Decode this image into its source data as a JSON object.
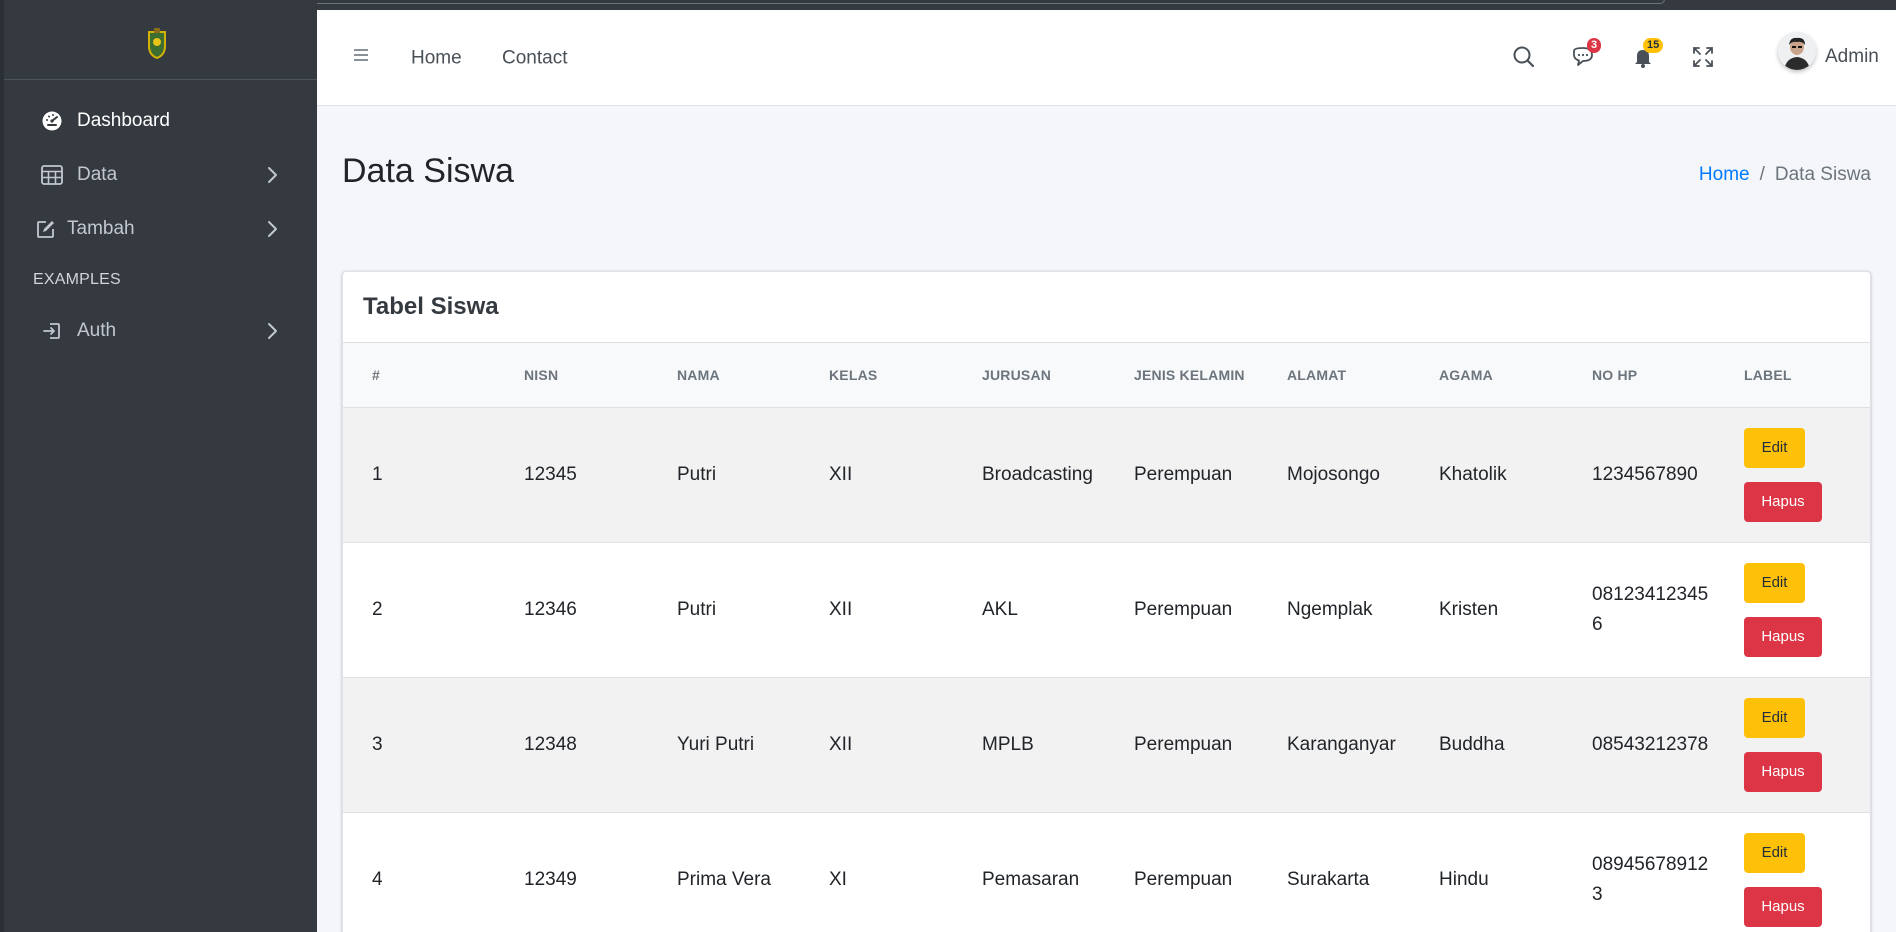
{
  "sidebar": {
    "items": [
      {
        "label": "Dashboard",
        "icon": "dashboard-icon"
      },
      {
        "label": "Data",
        "icon": "table-icon"
      },
      {
        "label": "Tambah",
        "icon": "edit-icon"
      },
      {
        "label": "Auth",
        "icon": "login-icon"
      }
    ],
    "section_header": "EXAMPLES"
  },
  "navbar": {
    "links": [
      "Home",
      "Contact"
    ],
    "messages_count": "3",
    "notifications_count": "15",
    "user_name": "Admin"
  },
  "page": {
    "title": "Data Siswa",
    "breadcrumb": {
      "home": "Home",
      "separator": "/",
      "current": "Data Siswa"
    }
  },
  "card": {
    "title": "Tabel Siswa",
    "columns": [
      "#",
      "NISN",
      "NAMA",
      "KELAS",
      "JURUSAN",
      "JENIS KELAMIN",
      "ALAMAT",
      "AGAMA",
      "NO HP",
      "LABEL"
    ],
    "rows": [
      {
        "no": "1",
        "nisn": "12345",
        "nama": "Putri",
        "kelas": "XII",
        "jurusan": "Broadcasting",
        "jk": "Perempuan",
        "alamat": "Mojosongo",
        "agama": "Khatolik",
        "hp1": "1234567890",
        "hp2": ""
      },
      {
        "no": "2",
        "nisn": "12346",
        "nama": "Putri",
        "kelas": "XII",
        "jurusan": "AKL",
        "jk": "Perempuan",
        "alamat": "Ngemplak",
        "agama": "Kristen",
        "hp1": "08123412345",
        "hp2": "6"
      },
      {
        "no": "3",
        "nisn": "12348",
        "nama": "Yuri Putri",
        "kelas": "XII",
        "jurusan": "MPLB",
        "jk": "Perempuan",
        "alamat": "Karanganyar",
        "agama": "Buddha",
        "hp1": "08543212378",
        "hp2": ""
      },
      {
        "no": "4",
        "nisn": "12349",
        "nama": "Prima Vera",
        "kelas": "XI",
        "jurusan": "Pemasaran",
        "jk": "Perempuan",
        "alamat": "Surakarta",
        "agama": "Hindu",
        "hp1": "08945678912",
        "hp2": "3"
      }
    ],
    "edit_label": "Edit",
    "delete_label": "Hapus"
  },
  "colors": {
    "sidebar_bg": "#343a40",
    "edit_button": "#ffc107",
    "delete_button": "#dc3545",
    "link": "#007bff"
  }
}
